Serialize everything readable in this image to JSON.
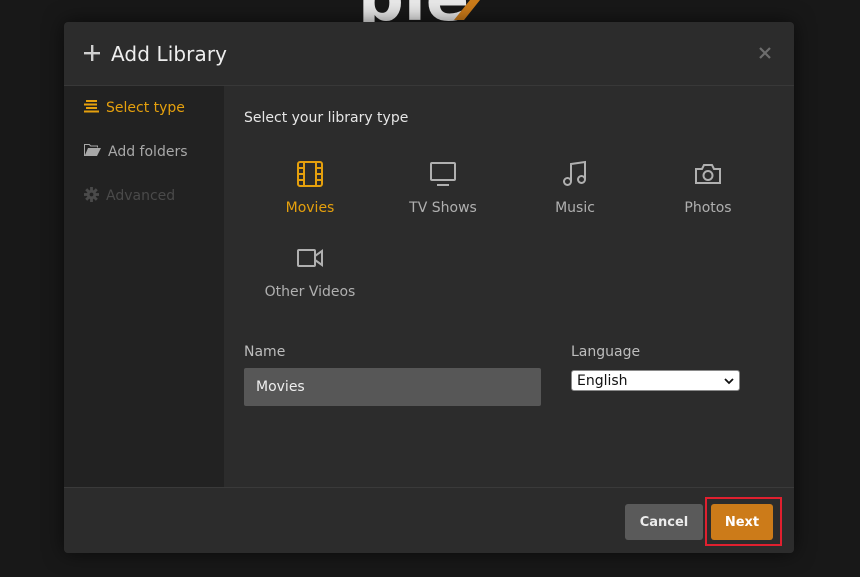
{
  "background": {
    "logo_icon": "plex-logo"
  },
  "dialog": {
    "title": "Add Library",
    "title_icon": "plus-icon",
    "close_icon": "close-icon"
  },
  "sidebar": {
    "items": [
      {
        "label": "Select type",
        "icon": "list-icon",
        "state": "active"
      },
      {
        "label": "Add folders",
        "icon": "folder-open-icon",
        "state": "normal"
      },
      {
        "label": "Advanced",
        "icon": "gear-icon",
        "state": "disabled"
      }
    ]
  },
  "main": {
    "prompt": "Select your library type",
    "types": [
      {
        "label": "Movies",
        "icon": "film-icon",
        "selected": true
      },
      {
        "label": "TV Shows",
        "icon": "tv-icon",
        "selected": false
      },
      {
        "label": "Music",
        "icon": "music-note-icon",
        "selected": false
      },
      {
        "label": "Photos",
        "icon": "camera-icon",
        "selected": false
      },
      {
        "label": "Other Videos",
        "icon": "video-camera-icon",
        "selected": false
      }
    ],
    "name_label": "Name",
    "name_value": "Movies",
    "language_label": "Language",
    "language_value": "English"
  },
  "footer": {
    "cancel_label": "Cancel",
    "next_label": "Next"
  },
  "colors": {
    "accent": "#e5a00d",
    "next_button": "#cc7b19",
    "highlight": "#e0202f"
  }
}
